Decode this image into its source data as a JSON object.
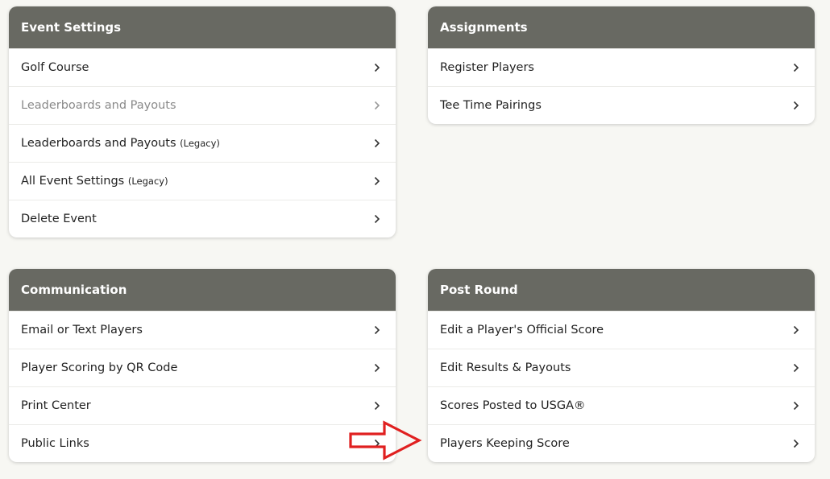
{
  "event_settings": {
    "title": "Event Settings",
    "items": [
      {
        "label": "Golf Course"
      },
      {
        "label": "Leaderboards and Payouts"
      },
      {
        "label": "Leaderboards and Payouts",
        "tag": "Legacy"
      },
      {
        "label": "All Event Settings",
        "tag": "Legacy"
      },
      {
        "label": "Delete Event"
      }
    ]
  },
  "assignments": {
    "title": "Assignments",
    "items": [
      {
        "label": "Register Players"
      },
      {
        "label": "Tee Time Pairings"
      }
    ]
  },
  "communication": {
    "title": "Communication",
    "items": [
      {
        "label": "Email or Text Players"
      },
      {
        "label": "Player Scoring by QR Code"
      },
      {
        "label": "Print Center"
      },
      {
        "label": "Public Links"
      }
    ]
  },
  "post_round": {
    "title": "Post Round",
    "items": [
      {
        "label": "Edit a Player's Official Score"
      },
      {
        "label": "Edit Results & Payouts"
      },
      {
        "label": "Scores Posted to USGA®"
      },
      {
        "label": "Players Keeping Score"
      }
    ]
  },
  "colors": {
    "header_bg": "#686962",
    "page_bg": "#f7f7f3",
    "annotation_arrow": "#e02020"
  },
  "icons": {
    "row_chevron": "chevron-right-icon",
    "annotation": "red-arrow-annotation"
  }
}
